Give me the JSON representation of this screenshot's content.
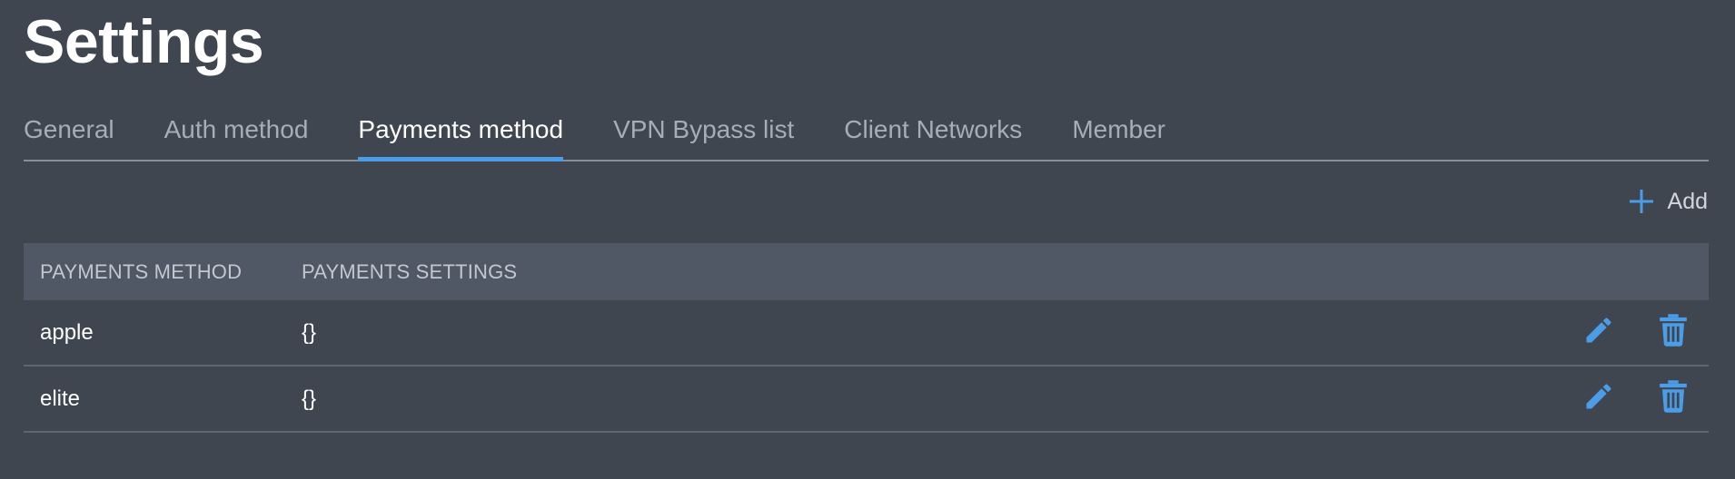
{
  "page": {
    "title": "Settings"
  },
  "tabs": [
    {
      "label": "General",
      "active": false
    },
    {
      "label": "Auth method",
      "active": false
    },
    {
      "label": "Payments method",
      "active": true
    },
    {
      "label": "VPN Bypass list",
      "active": false
    },
    {
      "label": "Client Networks",
      "active": false
    },
    {
      "label": "Member",
      "active": false
    }
  ],
  "toolbar": {
    "add_label": "Add",
    "add_icon": "plus-icon"
  },
  "table": {
    "columns": [
      "PAYMENTS METHOD",
      "PAYMENTS SETTINGS"
    ],
    "rows": [
      {
        "method": "apple",
        "settings": "{}"
      },
      {
        "method": "elite",
        "settings": "{}"
      }
    ],
    "row_actions": {
      "edit_icon": "pencil-icon",
      "delete_icon": "trash-icon"
    }
  },
  "colors": {
    "background": "#3f4650",
    "header_background": "#505866",
    "accent": "#4a9de6",
    "text": "#ffffff",
    "muted_text": "#a7adb6"
  }
}
